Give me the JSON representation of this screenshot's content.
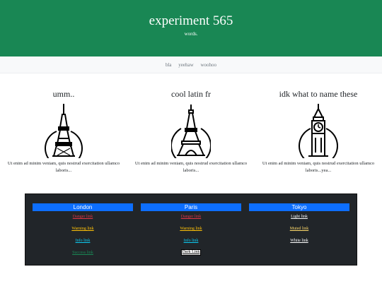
{
  "hero": {
    "title": "experiment 565",
    "subtitle": "words."
  },
  "nav": {
    "items": [
      "bla",
      "yeehaw",
      "woohoo"
    ]
  },
  "columns": [
    {
      "title": "umm..",
      "icon": "tokyo-tower-icon",
      "text": "Ut enim ad minim veniam, quis nostrud exercitation ullamco laboris..."
    },
    {
      "title": "cool latin fr",
      "icon": "eiffel-tower-icon",
      "text": "Ut enim ad minim veniam, quis nostrud exercitation ullamco laboris..."
    },
    {
      "title": "idk what to name these",
      "icon": "big-ben-icon",
      "text": "Ut enim ad minim veniam, quis nostrud exercitation ullamco laboris...yea..."
    }
  ],
  "cities": [
    {
      "name": "London",
      "links": [
        {
          "label": "Danger link",
          "color": "#dc3545"
        },
        {
          "label": "Warning link",
          "color": "#ffc107"
        },
        {
          "label": "Info link",
          "color": "#0dcaf0"
        },
        {
          "label": "Success link",
          "color": "#198754"
        }
      ]
    },
    {
      "name": "Paris",
      "links": [
        {
          "label": "Danger link",
          "color": "#dc3545"
        },
        {
          "label": "Warning link",
          "color": "#ffc107"
        },
        {
          "label": "Info link",
          "color": "#0dcaf0"
        },
        {
          "label": "Dark Link",
          "color": "#000000"
        }
      ]
    },
    {
      "name": "Tokyo",
      "links": [
        {
          "label": "Light link",
          "color": "#f8f9fa"
        },
        {
          "label": "Muted link",
          "color": "#ffda6a"
        },
        {
          "label": "White link",
          "color": "#ffffff"
        }
      ]
    }
  ],
  "colors": {
    "hero": "#198754",
    "city_header": "#0d6efd",
    "dark_panel": "#212529"
  }
}
